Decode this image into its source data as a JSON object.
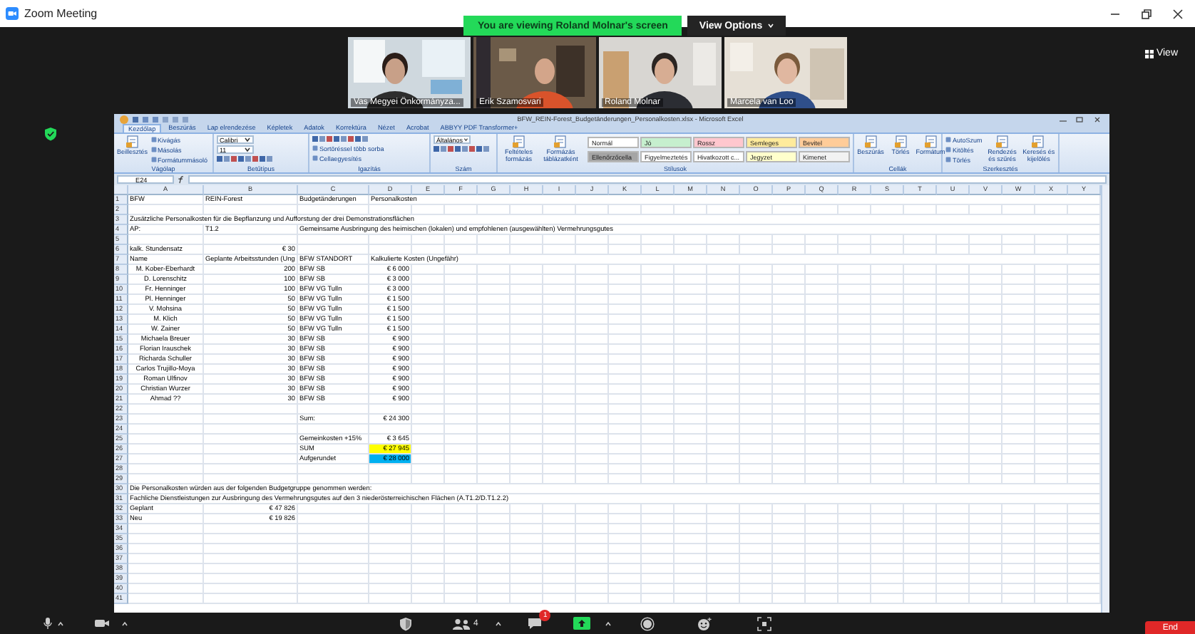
{
  "window": {
    "title": "Zoom Meeting"
  },
  "share_banner": {
    "text": "You are viewing Roland Molnar's screen",
    "options": "View Options"
  },
  "view_button": {
    "label": "View"
  },
  "participants": [
    {
      "name": "Vas Megyei Önkormányza..."
    },
    {
      "name": "Erik Szamosvari"
    },
    {
      "name": "Roland Molnar"
    },
    {
      "name": "Marcela van Loo"
    }
  ],
  "excel": {
    "title": "BFW_REIN-Forest_Budgetänderungen_Personalkosten.xlsx - Microsoft Excel",
    "tabs": [
      {
        "label": "Kezdőlap",
        "selected": true
      },
      {
        "label": "Beszúrás",
        "selected": false
      },
      {
        "label": "Lap elrendezése",
        "selected": false
      },
      {
        "label": "Képletek",
        "selected": false
      },
      {
        "label": "Adatok",
        "selected": false
      },
      {
        "label": "Korrektúra",
        "selected": false
      },
      {
        "label": "Nézet",
        "selected": false
      },
      {
        "label": "Acrobat",
        "selected": false
      },
      {
        "label": "ABBYY PDF Transformer+",
        "selected": false
      }
    ],
    "ribbon_groups": [
      {
        "label": "Vágólap",
        "items": [
          {
            "kind": "big",
            "label": "Beillesztés"
          },
          {
            "kind": "small",
            "label": "Kivágás"
          },
          {
            "kind": "small",
            "label": "Másolás"
          },
          {
            "kind": "small",
            "label": "Formátummásoló"
          }
        ]
      },
      {
        "label": "Betűtípus",
        "items": [
          {
            "kind": "field",
            "value": "Calibri"
          },
          {
            "kind": "field",
            "value": "11"
          },
          {
            "kind": "tools"
          }
        ]
      },
      {
        "label": "Igazítás",
        "items": [
          {
            "kind": "tools"
          },
          {
            "kind": "small",
            "label": "Sortöréssel több sorba"
          },
          {
            "kind": "small",
            "label": "Cellaegyesítés"
          }
        ]
      },
      {
        "label": "Szám",
        "items": [
          {
            "kind": "field",
            "value": "Általános"
          },
          {
            "kind": "tools"
          }
        ]
      },
      {
        "label": "Stílusok",
        "items": [
          {
            "kind": "big",
            "label": "Feltételes formázás"
          },
          {
            "kind": "big",
            "label": "Formázás táblázatként"
          },
          {
            "kind": "style",
            "label": "Normál",
            "color": "#ffffff"
          },
          {
            "kind": "style",
            "label": "Jó",
            "color": "#c6efce"
          },
          {
            "kind": "style",
            "label": "Rossz",
            "color": "#ffc7ce"
          },
          {
            "kind": "style",
            "label": "Semleges",
            "color": "#ffeb9c"
          },
          {
            "kind": "style",
            "label": "Bevitel",
            "color": "#ffcc99"
          },
          {
            "kind": "style",
            "label": "Ellenőrzőcella",
            "color": "#a5a5a5"
          },
          {
            "kind": "style",
            "label": "Figyelmeztetés",
            "color": "#ffffff"
          },
          {
            "kind": "style",
            "label": "Hivatkozott c...",
            "color": "#ffffff"
          },
          {
            "kind": "style",
            "label": "Jegyzet",
            "color": "#ffffcc"
          },
          {
            "kind": "style",
            "label": "Kimenet",
            "color": "#f2f2f2"
          }
        ]
      },
      {
        "label": "Cellák",
        "items": [
          {
            "kind": "big",
            "label": "Beszúrás"
          },
          {
            "kind": "big",
            "label": "Törlés"
          },
          {
            "kind": "big",
            "label": "Formátum"
          }
        ]
      },
      {
        "label": "Szerkesztés",
        "items": [
          {
            "kind": "small",
            "label": "AutoSzum"
          },
          {
            "kind": "small",
            "label": "Kitöltés"
          },
          {
            "kind": "small",
            "label": "Törlés"
          },
          {
            "kind": "big",
            "label": "Rendezés és szűrés"
          },
          {
            "kind": "big",
            "label": "Keresés és kijelölés"
          }
        ]
      }
    ],
    "name_box": "E24",
    "columns": [
      "A",
      "B",
      "C",
      "D",
      "E",
      "F",
      "G",
      "H",
      "I",
      "J",
      "K",
      "L",
      "M",
      "N",
      "O",
      "P",
      "Q",
      "R",
      "S",
      "T",
      "U",
      "V",
      "W",
      "X",
      "Y"
    ],
    "rows": [
      {
        "number": "1",
        "cells": {
          "A": {
            "text": "BFW",
            "kind": "label"
          },
          "B": {
            "text": "REIN-Forest",
            "kind": "label"
          },
          "C": {
            "text": "Budgetänderungen",
            "kind": "label"
          },
          "D": {
            "text": "Personalkosten",
            "kind": "label"
          }
        }
      },
      {
        "number": "2"
      },
      {
        "number": "3",
        "cells": {
          "A": {
            "text": "Zusätzliche Personalkosten für die Bepflanzung und Aufforstung der drei Demonstrationsflächen",
            "kind": "label"
          }
        }
      },
      {
        "number": "4",
        "cells": {
          "A": {
            "text": "AP:",
            "kind": "label"
          },
          "B": {
            "text": "T1.2",
            "kind": "label"
          },
          "C": {
            "text": "Gemeinsame Ausbringung des heimischen (lokalen) und empfohlenen (ausgewählten) Vermehrungsgutes",
            "kind": "label"
          }
        }
      },
      {
        "number": "5"
      },
      {
        "number": "6",
        "cells": {
          "A": {
            "text": "kalk. Stundensatz",
            "kind": "label"
          },
          "B": {
            "text": "€ 30",
            "kind": "number"
          }
        }
      },
      {
        "number": "7",
        "cells": {
          "A": {
            "text": "Name",
            "kind": "label"
          },
          "B": {
            "text": "Geplante Arbeitsstunden (Ung",
            "kind": "label"
          },
          "C": {
            "text": "BFW STANDORT",
            "kind": "label"
          },
          "D": {
            "text": "Kalkulierte Kosten (Ungefähr)",
            "kind": "label"
          }
        }
      },
      {
        "number": "8",
        "cells": {
          "A": {
            "text": "M. Kober-Eberhardt",
            "kind": "name"
          },
          "B": {
            "text": "200",
            "kind": "number"
          },
          "C": {
            "text": "BFW SB",
            "kind": "label"
          },
          "D": {
            "text": "€ 6 000",
            "kind": "number"
          }
        }
      },
      {
        "number": "9",
        "cells": {
          "A": {
            "text": "D. Lorenschitz",
            "kind": "name"
          },
          "B": {
            "text": "100",
            "kind": "number"
          },
          "C": {
            "text": "BFW SB",
            "kind": "label"
          },
          "D": {
            "text": "€ 3 000",
            "kind": "number"
          }
        }
      },
      {
        "number": "10",
        "cells": {
          "A": {
            "text": "Fr. Henninger",
            "kind": "name"
          },
          "B": {
            "text": "100",
            "kind": "number"
          },
          "C": {
            "text": "BFW VG Tulln",
            "kind": "label"
          },
          "D": {
            "text": "€ 3 000",
            "kind": "number"
          }
        }
      },
      {
        "number": "11",
        "cells": {
          "A": {
            "text": "Pl. Henninger",
            "kind": "name"
          },
          "B": {
            "text": "50",
            "kind": "number"
          },
          "C": {
            "text": "BFW VG Tulln",
            "kind": "label"
          },
          "D": {
            "text": "€ 1 500",
            "kind": "number"
          }
        }
      },
      {
        "number": "12",
        "cells": {
          "A": {
            "text": "V. Mohsina",
            "kind": "name"
          },
          "B": {
            "text": "50",
            "kind": "number"
          },
          "C": {
            "text": "BFW VG Tulln",
            "kind": "label"
          },
          "D": {
            "text": "€ 1 500",
            "kind": "number"
          }
        }
      },
      {
        "number": "13",
        "cells": {
          "A": {
            "text": "M. Klich",
            "kind": "name"
          },
          "B": {
            "text": "50",
            "kind": "number"
          },
          "C": {
            "text": "BFW VG Tulln",
            "kind": "label"
          },
          "D": {
            "text": "€ 1 500",
            "kind": "number"
          }
        }
      },
      {
        "number": "14",
        "cells": {
          "A": {
            "text": "W. Zainer",
            "kind": "name"
          },
          "B": {
            "text": "50",
            "kind": "number"
          },
          "C": {
            "text": "BFW VG Tulln",
            "kind": "label"
          },
          "D": {
            "text": "€ 1 500",
            "kind": "number"
          }
        }
      },
      {
        "number": "15",
        "cells": {
          "A": {
            "text": "Michaela Breuer",
            "kind": "name"
          },
          "B": {
            "text": "30",
            "kind": "number"
          },
          "C": {
            "text": "BFW SB",
            "kind": "label"
          },
          "D": {
            "text": "€ 900",
            "kind": "number"
          }
        }
      },
      {
        "number": "16",
        "cells": {
          "A": {
            "text": "Florian Irauschek",
            "kind": "name"
          },
          "B": {
            "text": "30",
            "kind": "number"
          },
          "C": {
            "text": "BFW SB",
            "kind": "label"
          },
          "D": {
            "text": "€ 900",
            "kind": "number"
          }
        }
      },
      {
        "number": "17",
        "cells": {
          "A": {
            "text": "Richarda Schuller",
            "kind": "name"
          },
          "B": {
            "text": "30",
            "kind": "number"
          },
          "C": {
            "text": "BFW SB",
            "kind": "label"
          },
          "D": {
            "text": "€ 900",
            "kind": "number"
          }
        }
      },
      {
        "number": "18",
        "cells": {
          "A": {
            "text": "Carlos Trujillo-Moya",
            "kind": "name"
          },
          "B": {
            "text": "30",
            "kind": "number"
          },
          "C": {
            "text": "BFW SB",
            "kind": "label"
          },
          "D": {
            "text": "€ 900",
            "kind": "number"
          }
        }
      },
      {
        "number": "19",
        "cells": {
          "A": {
            "text": "Roman Ulfinov",
            "kind": "name"
          },
          "B": {
            "text": "30",
            "kind": "number"
          },
          "C": {
            "text": "BFW SB",
            "kind": "label"
          },
          "D": {
            "text": "€ 900",
            "kind": "number"
          }
        }
      },
      {
        "number": "20",
        "cells": {
          "A": {
            "text": "Christian Wurzer",
            "kind": "name"
          },
          "B": {
            "text": "30",
            "kind": "number"
          },
          "C": {
            "text": "BFW SB",
            "kind": "label"
          },
          "D": {
            "text": "€ 900",
            "kind": "number"
          }
        }
      },
      {
        "number": "21",
        "cells": {
          "A": {
            "text": "Ahmad ??",
            "kind": "name"
          },
          "B": {
            "text": "30",
            "kind": "number"
          },
          "C": {
            "text": "BFW SB",
            "kind": "label"
          },
          "D": {
            "text": "€ 900",
            "kind": "number"
          }
        }
      },
      {
        "number": "22"
      },
      {
        "number": "23",
        "cells": {
          "C": {
            "text": "Sum:",
            "kind": "label"
          },
          "D": {
            "text": "€ 24 300",
            "kind": "number"
          }
        }
      },
      {
        "number": "24"
      },
      {
        "number": "25",
        "cells": {
          "C": {
            "text": "Gemeinkosten +15%",
            "kind": "label"
          },
          "D": {
            "text": "€ 3 645",
            "kind": "number"
          }
        }
      },
      {
        "number": "26",
        "cells": {
          "C": {
            "text": "SUM",
            "kind": "label"
          },
          "D": {
            "text": "€ 27 945",
            "kind": "number",
            "color": "#ffff00"
          }
        }
      },
      {
        "number": "27",
        "cells": {
          "C": {
            "text": "Aufgerundet",
            "kind": "label"
          },
          "D": {
            "text": "€ 28 000",
            "kind": "number",
            "color": "#00b0f0"
          }
        }
      },
      {
        "number": "28"
      },
      {
        "number": "29"
      },
      {
        "number": "30",
        "cells": {
          "A": {
            "text": "Die Personalkosten würden aus der folgenden Budgetgruppe genommen werden:",
            "kind": "label"
          }
        }
      },
      {
        "number": "31",
        "cells": {
          "A": {
            "text": "Fachliche Dienstleistungen zur Ausbringung des Vermehrungsgutes auf den 3 niederösterreichischen Flächen (A.T1.2/D.T1.2.2)",
            "kind": "label"
          }
        }
      },
      {
        "number": "32",
        "cells": {
          "A": {
            "text": "Geplant",
            "kind": "label"
          },
          "B": {
            "text": "€ 47 826",
            "kind": "number"
          }
        }
      },
      {
        "number": "33",
        "cells": {
          "A": {
            "text": "Neu",
            "kind": "label"
          },
          "B": {
            "text": "€ 19 826",
            "kind": "number"
          }
        }
      },
      {
        "number": "34"
      },
      {
        "number": "35"
      },
      {
        "number": "36"
      },
      {
        "number": "37"
      },
      {
        "number": "38"
      },
      {
        "number": "39"
      },
      {
        "number": "40"
      },
      {
        "number": "41"
      }
    ]
  },
  "toolbar": {
    "participants_count": "4",
    "chat_badge": "1",
    "end_label": "End"
  }
}
